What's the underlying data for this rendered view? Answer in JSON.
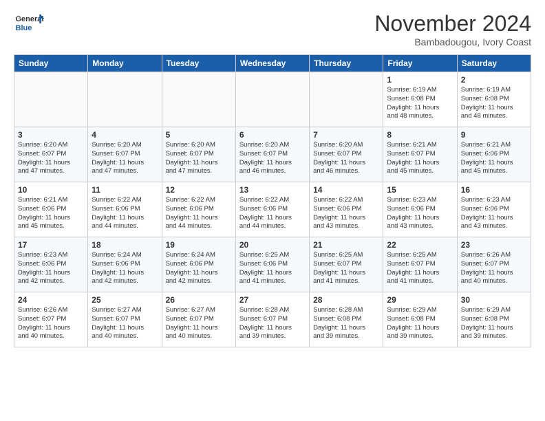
{
  "logo": {
    "line1": "General",
    "line2": "Blue"
  },
  "title": "November 2024",
  "location": "Bambadougou, Ivory Coast",
  "days_of_week": [
    "Sunday",
    "Monday",
    "Tuesday",
    "Wednesday",
    "Thursday",
    "Friday",
    "Saturday"
  ],
  "weeks": [
    [
      {
        "day": "",
        "text": ""
      },
      {
        "day": "",
        "text": ""
      },
      {
        "day": "",
        "text": ""
      },
      {
        "day": "",
        "text": ""
      },
      {
        "day": "",
        "text": ""
      },
      {
        "day": "1",
        "text": "Sunrise: 6:19 AM\nSunset: 6:08 PM\nDaylight: 11 hours\nand 48 minutes."
      },
      {
        "day": "2",
        "text": "Sunrise: 6:19 AM\nSunset: 6:08 PM\nDaylight: 11 hours\nand 48 minutes."
      }
    ],
    [
      {
        "day": "3",
        "text": "Sunrise: 6:20 AM\nSunset: 6:07 PM\nDaylight: 11 hours\nand 47 minutes."
      },
      {
        "day": "4",
        "text": "Sunrise: 6:20 AM\nSunset: 6:07 PM\nDaylight: 11 hours\nand 47 minutes."
      },
      {
        "day": "5",
        "text": "Sunrise: 6:20 AM\nSunset: 6:07 PM\nDaylight: 11 hours\nand 47 minutes."
      },
      {
        "day": "6",
        "text": "Sunrise: 6:20 AM\nSunset: 6:07 PM\nDaylight: 11 hours\nand 46 minutes."
      },
      {
        "day": "7",
        "text": "Sunrise: 6:20 AM\nSunset: 6:07 PM\nDaylight: 11 hours\nand 46 minutes."
      },
      {
        "day": "8",
        "text": "Sunrise: 6:21 AM\nSunset: 6:07 PM\nDaylight: 11 hours\nand 45 minutes."
      },
      {
        "day": "9",
        "text": "Sunrise: 6:21 AM\nSunset: 6:06 PM\nDaylight: 11 hours\nand 45 minutes."
      }
    ],
    [
      {
        "day": "10",
        "text": "Sunrise: 6:21 AM\nSunset: 6:06 PM\nDaylight: 11 hours\nand 45 minutes."
      },
      {
        "day": "11",
        "text": "Sunrise: 6:22 AM\nSunset: 6:06 PM\nDaylight: 11 hours\nand 44 minutes."
      },
      {
        "day": "12",
        "text": "Sunrise: 6:22 AM\nSunset: 6:06 PM\nDaylight: 11 hours\nand 44 minutes."
      },
      {
        "day": "13",
        "text": "Sunrise: 6:22 AM\nSunset: 6:06 PM\nDaylight: 11 hours\nand 44 minutes."
      },
      {
        "day": "14",
        "text": "Sunrise: 6:22 AM\nSunset: 6:06 PM\nDaylight: 11 hours\nand 43 minutes."
      },
      {
        "day": "15",
        "text": "Sunrise: 6:23 AM\nSunset: 6:06 PM\nDaylight: 11 hours\nand 43 minutes."
      },
      {
        "day": "16",
        "text": "Sunrise: 6:23 AM\nSunset: 6:06 PM\nDaylight: 11 hours\nand 43 minutes."
      }
    ],
    [
      {
        "day": "17",
        "text": "Sunrise: 6:23 AM\nSunset: 6:06 PM\nDaylight: 11 hours\nand 42 minutes."
      },
      {
        "day": "18",
        "text": "Sunrise: 6:24 AM\nSunset: 6:06 PM\nDaylight: 11 hours\nand 42 minutes."
      },
      {
        "day": "19",
        "text": "Sunrise: 6:24 AM\nSunset: 6:06 PM\nDaylight: 11 hours\nand 42 minutes."
      },
      {
        "day": "20",
        "text": "Sunrise: 6:25 AM\nSunset: 6:06 PM\nDaylight: 11 hours\nand 41 minutes."
      },
      {
        "day": "21",
        "text": "Sunrise: 6:25 AM\nSunset: 6:07 PM\nDaylight: 11 hours\nand 41 minutes."
      },
      {
        "day": "22",
        "text": "Sunrise: 6:25 AM\nSunset: 6:07 PM\nDaylight: 11 hours\nand 41 minutes."
      },
      {
        "day": "23",
        "text": "Sunrise: 6:26 AM\nSunset: 6:07 PM\nDaylight: 11 hours\nand 40 minutes."
      }
    ],
    [
      {
        "day": "24",
        "text": "Sunrise: 6:26 AM\nSunset: 6:07 PM\nDaylight: 11 hours\nand 40 minutes."
      },
      {
        "day": "25",
        "text": "Sunrise: 6:27 AM\nSunset: 6:07 PM\nDaylight: 11 hours\nand 40 minutes."
      },
      {
        "day": "26",
        "text": "Sunrise: 6:27 AM\nSunset: 6:07 PM\nDaylight: 11 hours\nand 40 minutes."
      },
      {
        "day": "27",
        "text": "Sunrise: 6:28 AM\nSunset: 6:07 PM\nDaylight: 11 hours\nand 39 minutes."
      },
      {
        "day": "28",
        "text": "Sunrise: 6:28 AM\nSunset: 6:08 PM\nDaylight: 11 hours\nand 39 minutes."
      },
      {
        "day": "29",
        "text": "Sunrise: 6:29 AM\nSunset: 6:08 PM\nDaylight: 11 hours\nand 39 minutes."
      },
      {
        "day": "30",
        "text": "Sunrise: 6:29 AM\nSunset: 6:08 PM\nDaylight: 11 hours\nand 39 minutes."
      }
    ]
  ]
}
